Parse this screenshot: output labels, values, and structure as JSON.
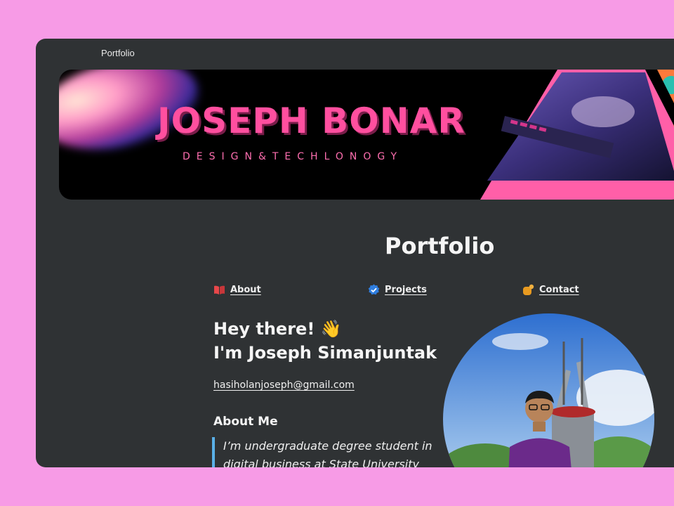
{
  "window": {
    "title": "Portfolio"
  },
  "banner": {
    "name": "JOSEPH BONAR",
    "subtitle": "DESIGN&TECHLONOGY"
  },
  "page": {
    "title": "Portfolio"
  },
  "nav": [
    {
      "label": "About",
      "icon": "book-icon",
      "color": "#e8474a"
    },
    {
      "label": "Projects",
      "icon": "verified-badge-icon",
      "color": "#2f7ee0"
    },
    {
      "label": "Contact",
      "icon": "contact-icon",
      "color": "#e89a20"
    }
  ],
  "intro": {
    "greeting_line1": "Hey there!",
    "wave_emoji": "👋",
    "greeting_line2": "I'm Joseph Simanjuntak",
    "email": "hasiholanjoseph@gmail.com"
  },
  "about": {
    "heading": "About Me",
    "text": "I’m undergraduate degree student in digital business at State University"
  },
  "colors": {
    "background": "#f79be6",
    "window": "#2f3234",
    "accent_pink": "#ff4f9f",
    "quote_border": "#5ab0e8"
  }
}
